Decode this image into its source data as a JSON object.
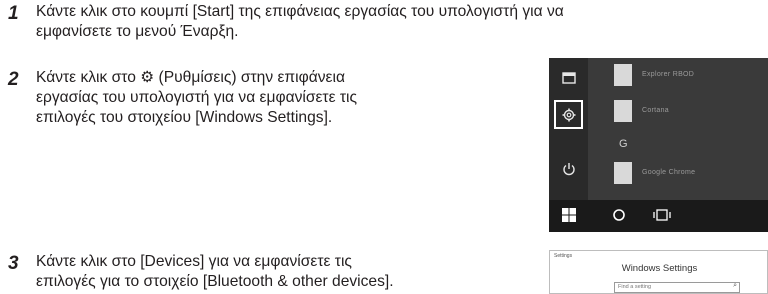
{
  "steps": [
    {
      "number": "1",
      "line1": "Κάντε κλικ στο κουμπί [Start] της επιφάνειας εργασίας του υπολογιστή για να",
      "line2": "εμφανίσετε το μενού Έναρξη."
    },
    {
      "number": "2",
      "line1": "Κάντε κλικ στο ⚙ (Ρυθμίσεις) στην επιφάνεια",
      "line2": "εργασίας του υπολογιστή για να εμφανίσετε τις",
      "line3": "επιλογές του στοιχείου [Windows Settings]."
    },
    {
      "number": "3",
      "line1": "Κάντε κλικ στο [Devices] για να εμφανίσετε τις",
      "line2": "επιλογές για το στοιχείο [Bluetooth & other devices]."
    }
  ],
  "start_menu": {
    "group_letter": "G",
    "apps": [
      "Explorer RBOD",
      "Cortana",
      "Google Chrome"
    ],
    "rail_icons": [
      "documents-icon",
      "settings-icon",
      "power-icon"
    ],
    "taskbar_icons": [
      "windows-logo-icon",
      "cortana-circle-icon",
      "task-view-icon"
    ]
  },
  "windows_settings": {
    "window_label": "Settings",
    "title": "Windows Settings",
    "search_placeholder": "Find a setting"
  }
}
